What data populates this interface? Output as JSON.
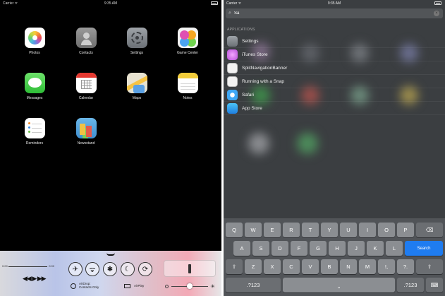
{
  "left_screen": {
    "status": {
      "carrier": "Carrier ᯤ",
      "time": "9:35 AM"
    },
    "apps": [
      {
        "name": "Photos",
        "icon": "photos-icon"
      },
      {
        "name": "Contacts",
        "icon": "contacts-icon"
      },
      {
        "name": "Settings",
        "icon": "settings-icon"
      },
      {
        "name": "Game Center",
        "icon": "game-center-icon"
      },
      {
        "name": "Messages",
        "icon": "messages-icon"
      },
      {
        "name": "Calendar",
        "icon": "calendar-icon"
      },
      {
        "name": "Maps",
        "icon": "maps-icon"
      },
      {
        "name": "Notes",
        "icon": "notes-icon"
      },
      {
        "name": "Reminders",
        "icon": "reminders-icon"
      },
      {
        "name": "Newsstand",
        "icon": "newsstand-icon"
      }
    ],
    "control_center": {
      "time_start": "0:00",
      "time_end": "0:00",
      "transport": "◀◀ ▶ ▶▶",
      "toggles": [
        "✈",
        "ᯤ",
        "✱",
        "☾",
        "⟳"
      ],
      "airdrop_title": "AirDrop:",
      "airdrop_value": "Contacts Only",
      "airplay_label": "AirPlay",
      "brightness_level": 0.5
    }
  },
  "right_screen": {
    "status": {
      "carrier": "Carrier ᯤ",
      "time": "9:35 AM"
    },
    "search": {
      "query": "Sa",
      "clear_icon": "×"
    },
    "section_title": "APPLICATIONS",
    "results": [
      {
        "label": "Settings",
        "icon": "settings-icon"
      },
      {
        "label": "iTunes Store",
        "icon": "itunes-store-icon"
      },
      {
        "label": "SplitNavigationBanner",
        "icon": "split-navigation-banner-icon"
      },
      {
        "label": "Running with a Snap",
        "icon": "running-with-a-snap-icon"
      },
      {
        "label": "Safari",
        "icon": "safari-icon"
      },
      {
        "label": "App Store",
        "icon": "app-store-icon"
      }
    ],
    "keyboard": {
      "row1": [
        "Q",
        "W",
        "E",
        "R",
        "T",
        "Y",
        "U",
        "I",
        "O",
        "P"
      ],
      "backspace": "⌫",
      "row2": [
        "A",
        "S",
        "D",
        "F",
        "G",
        "H",
        "J",
        "K",
        "L"
      ],
      "search_key": "Search",
      "shift": "⇧",
      "row3": [
        "Z",
        "X",
        "C",
        "V",
        "B",
        "N",
        "M",
        "!,",
        "?."
      ],
      "numbers": ".?123",
      "space": "⎵",
      "hide": "⌨"
    }
  }
}
